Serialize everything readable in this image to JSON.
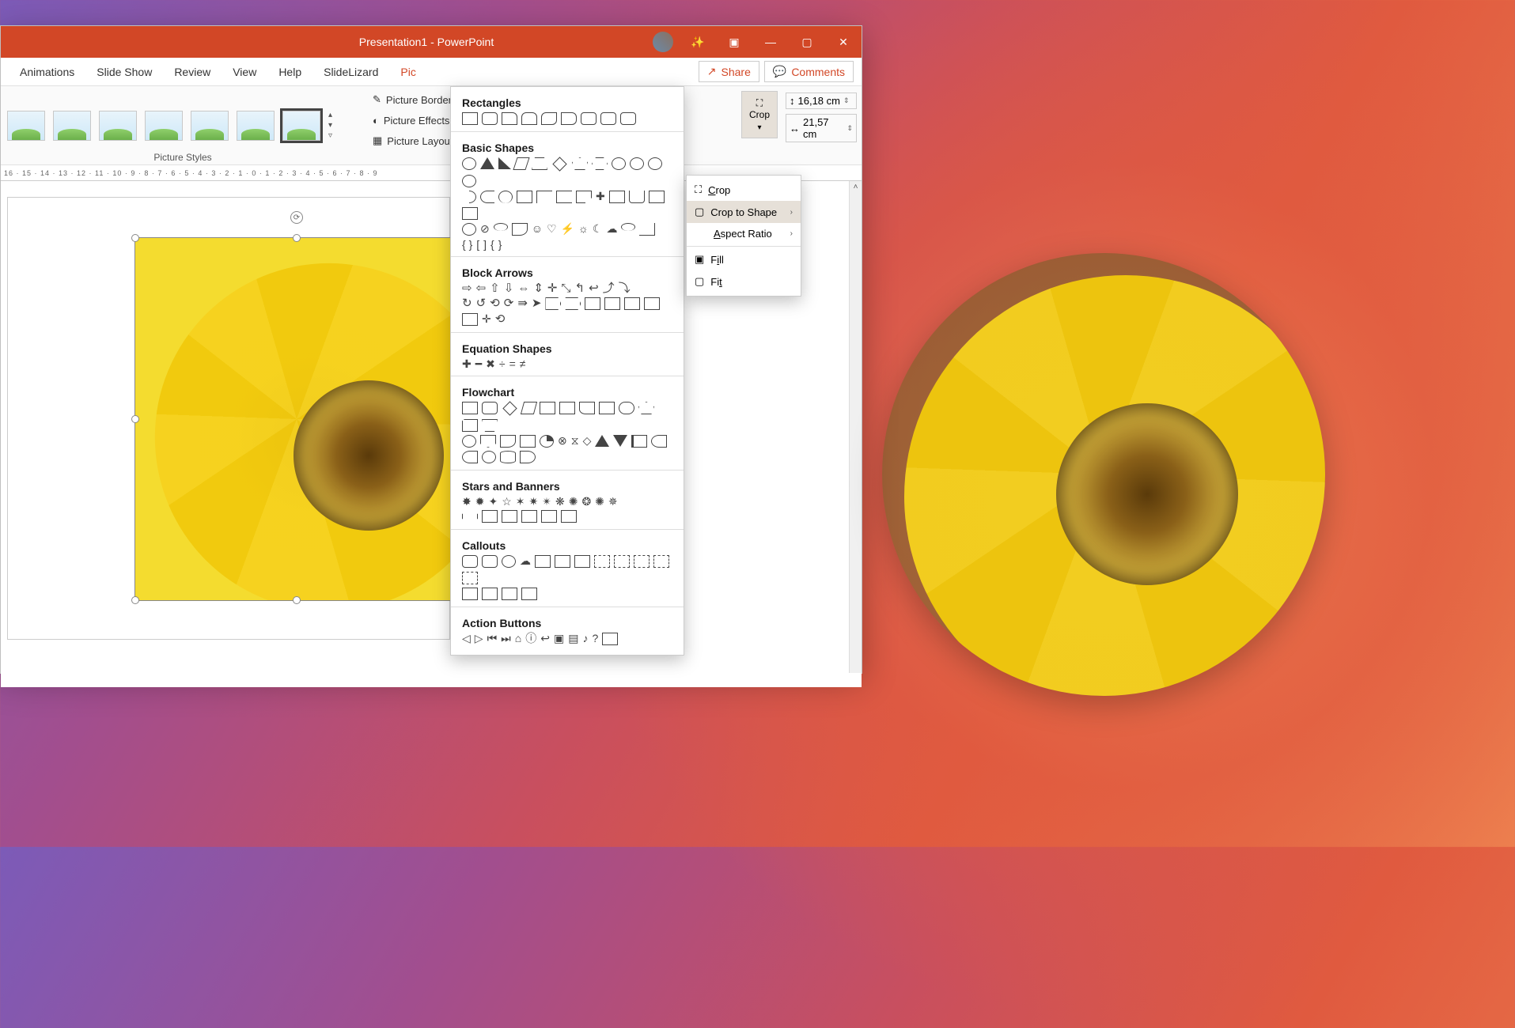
{
  "titlebar": {
    "title": "Presentation1  -  PowerPoint"
  },
  "tabs": {
    "items": [
      "Animations",
      "Slide Show",
      "Review",
      "View",
      "Help",
      "SlideLizard",
      "Picture Format"
    ],
    "active_index": 6,
    "share": "Share",
    "comments": "Comments"
  },
  "ribbon": {
    "picture_styles_label": "Picture Styles",
    "picture_border": "Picture Border",
    "picture_effects": "Picture Effects",
    "picture_layout": "Picture Layout",
    "crop_label": "Crop",
    "height": "16,18 cm",
    "width": "21,57 cm"
  },
  "ruler": "16 · 15 · 14 · 13 · 12 · 11 · 10 · 9 · 8 · 7 · 6 · 5 · 4 · 3 · 2 · 1 · 0 · 1 · 2 · 3 · 4 · 5 · 6 · 7 · 8 · 9",
  "crop_menu": {
    "crop": "Crop",
    "crop_to_shape": "Crop to Shape",
    "aspect_ratio": "Aspect Ratio",
    "fill": "Fill",
    "fit": "Fit"
  },
  "shape_gallery": {
    "rectangles": "Rectangles",
    "basic_shapes": "Basic Shapes",
    "block_arrows": "Block Arrows",
    "equation_shapes": "Equation Shapes",
    "flowchart": "Flowchart",
    "stars_and_banners": "Stars and Banners",
    "callouts": "Callouts",
    "action_buttons": "Action Buttons"
  }
}
